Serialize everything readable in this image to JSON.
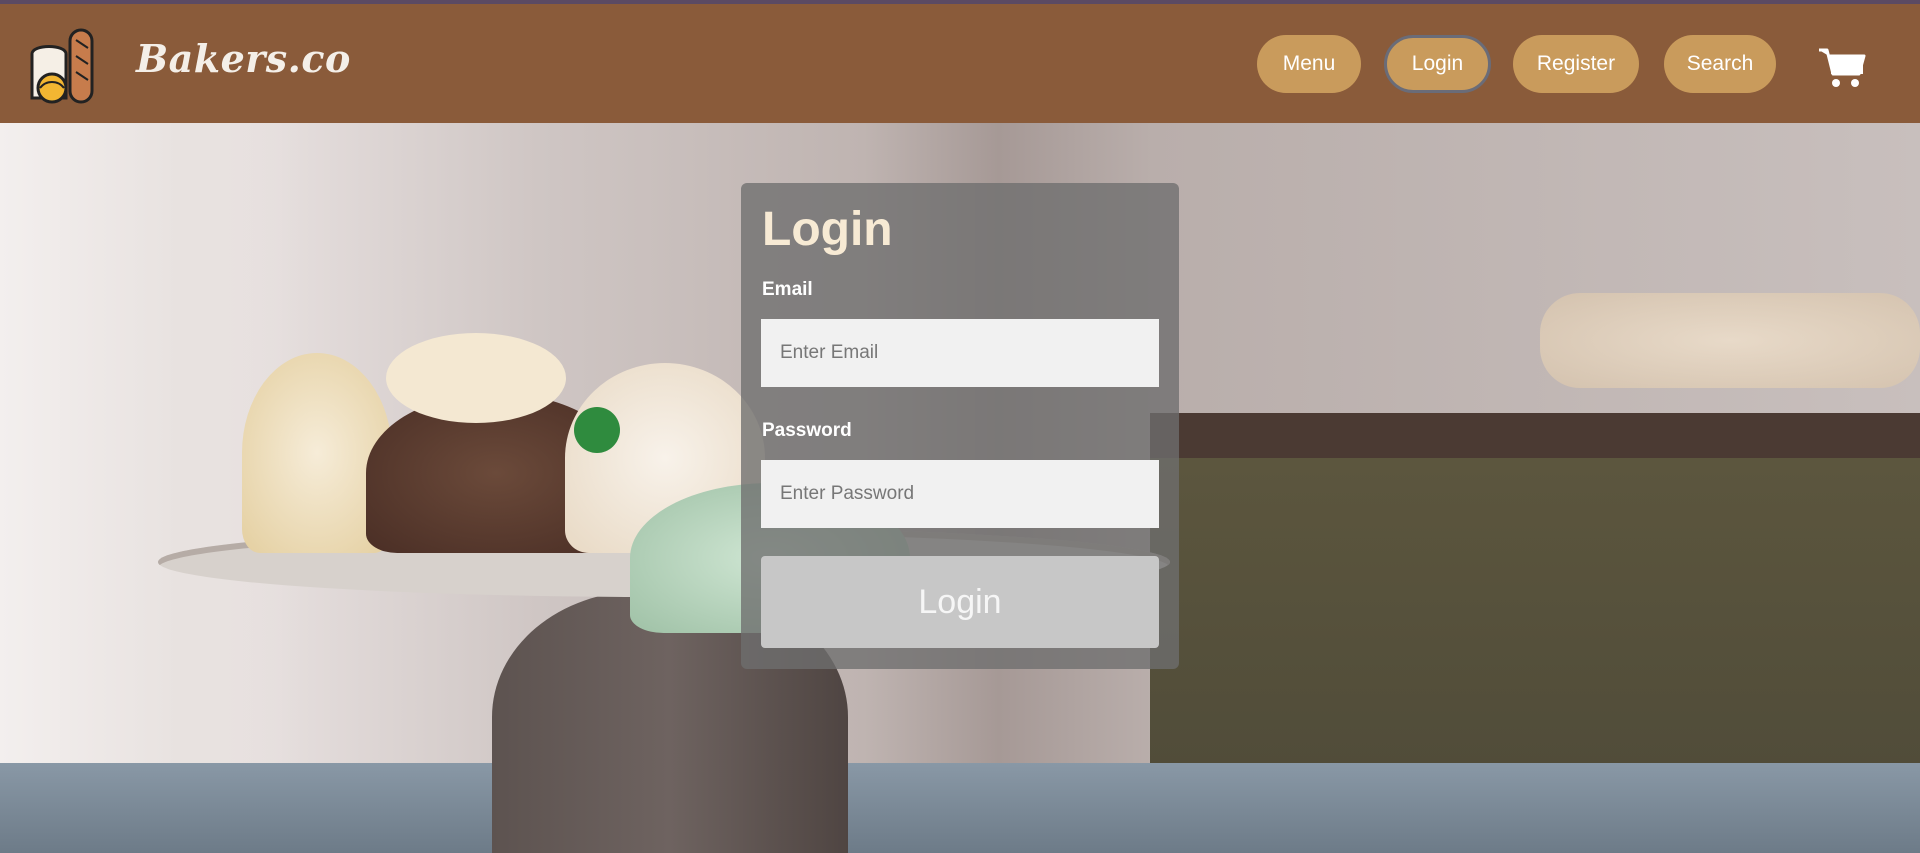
{
  "header": {
    "brand": "Bakers.co",
    "logo_icon": "bakery-bread-logo-icon",
    "nav": {
      "menu": "Menu",
      "login": "Login",
      "register": "Register",
      "search": "Search"
    },
    "cart_icon": "shopping-cart-icon"
  },
  "login_form": {
    "title": "Login",
    "email_label": "Email",
    "email_placeholder": "Enter Email",
    "password_label": "Password",
    "password_placeholder": "Enter Password",
    "submit_label": "Login"
  },
  "colors": {
    "header_bg": "#8a5b3a",
    "nav_button_bg": "#c99b5c",
    "brand_text": "#f4efe8",
    "card_title": "#f7ead4"
  }
}
